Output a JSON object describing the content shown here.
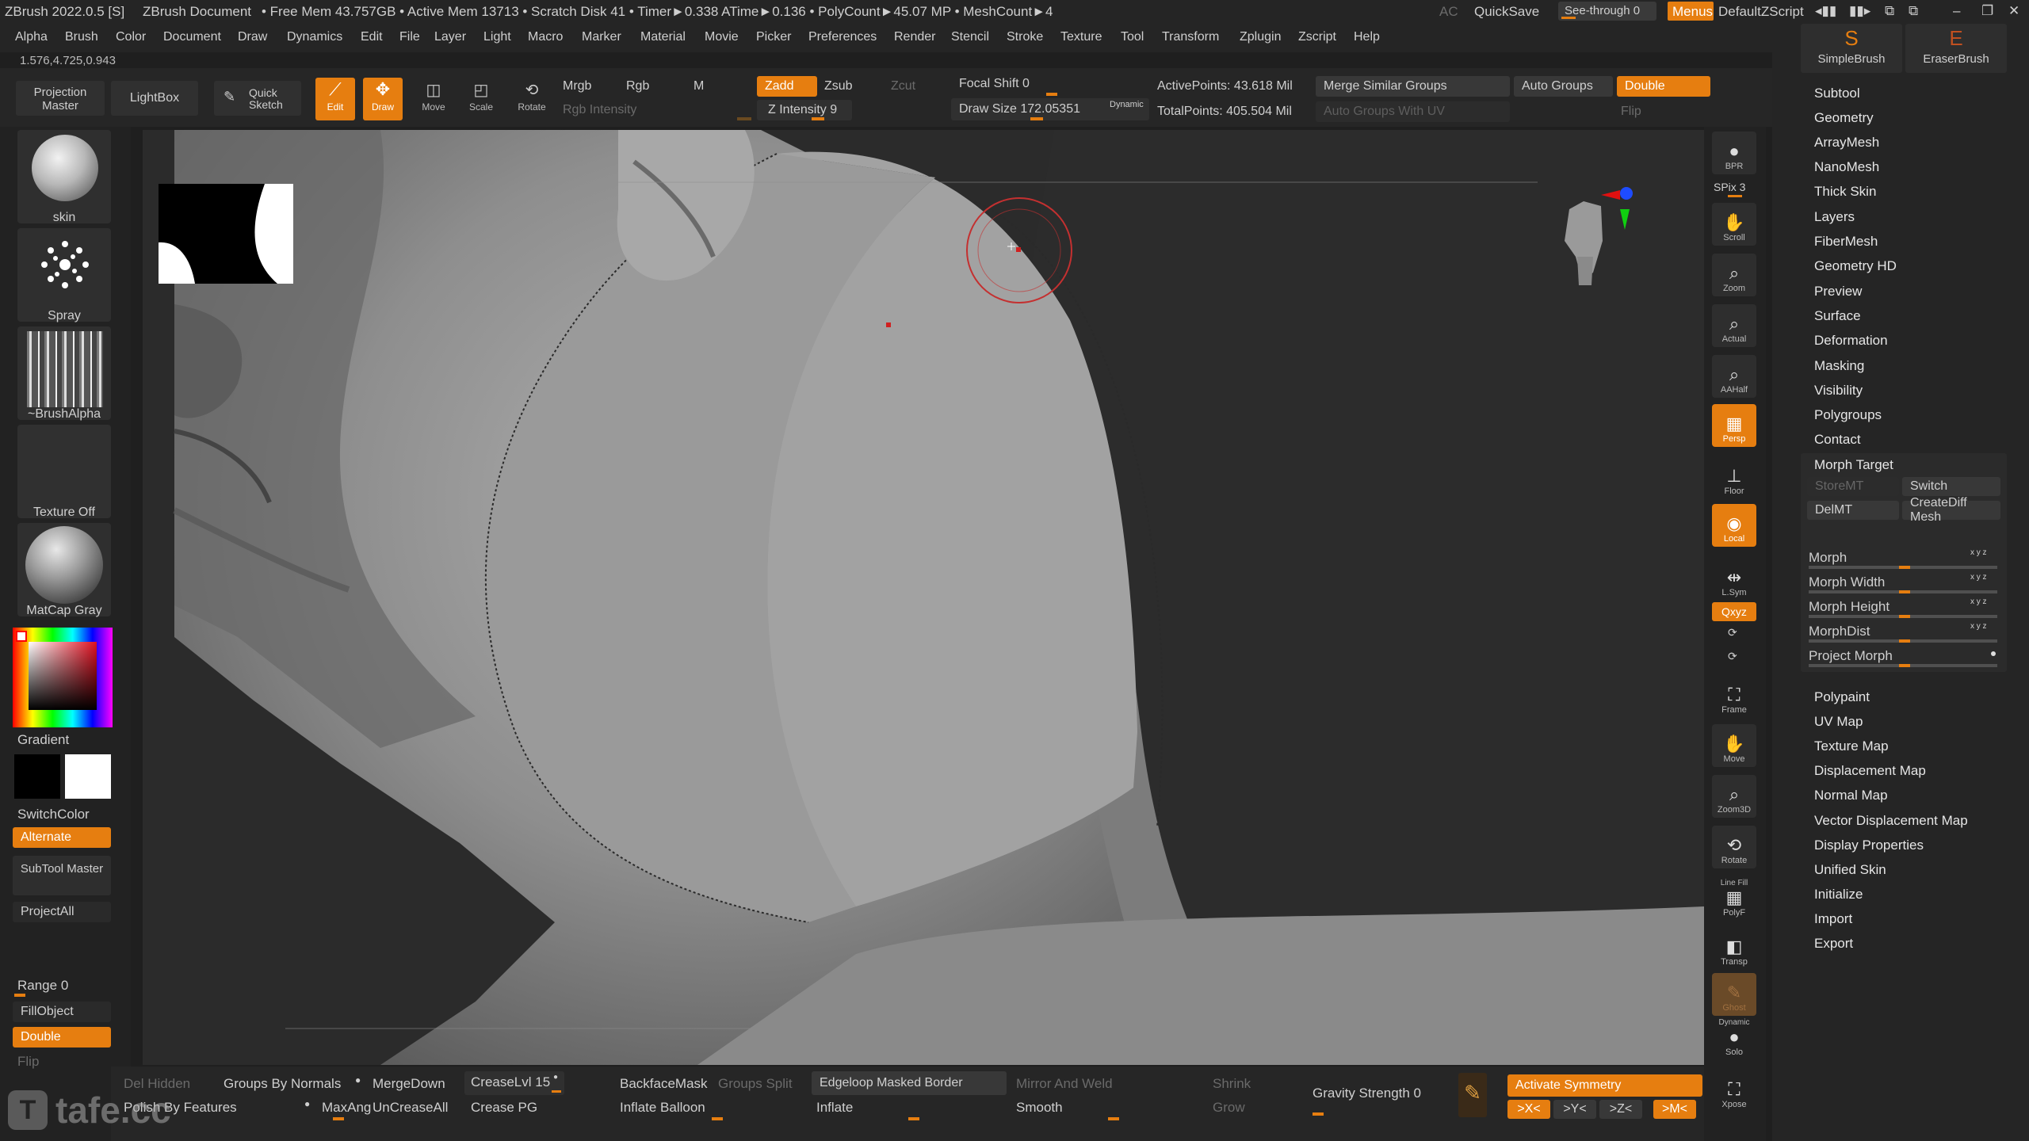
{
  "titlebar": {
    "app_title": "ZBrush 2022.0.5 [S]",
    "document": "ZBrush Document",
    "stats": "• Free Mem 43.757GB • Active Mem 13713 • Scratch Disk 41 • Timer►0.338 ATime►0.136 • PolyCount►45.07 MP • MeshCount►4",
    "ac": "AC",
    "quicksave": "QuickSave",
    "see_through": "See-through  0",
    "menus": "Menus",
    "default_zscript": "DefaultZScript"
  },
  "menubar": {
    "items": [
      "Alpha",
      "Brush",
      "Color",
      "Document",
      "Draw",
      "Dynamics",
      "Edit",
      "File",
      "Layer",
      "Light",
      "Macro",
      "Marker",
      "Material",
      "Movie",
      "Picker",
      "Preferences",
      "Render",
      "Stencil",
      "Stroke",
      "Texture",
      "Tool",
      "Transform",
      "Zplugin",
      "Zscript",
      "Help"
    ],
    "coords": "1.576,4.725,0.943"
  },
  "top_toolbar": {
    "projection_master": "Projection Master",
    "lightbox": "LightBox",
    "quick_sketch": "Quick Sketch",
    "edit": "Edit",
    "draw": "Draw",
    "move": "Move",
    "scale": "Scale",
    "rotate": "Rotate",
    "mrgb": "Mrgb",
    "rgb": "Rgb",
    "m": "M",
    "rgb_intensity": "Rgb Intensity",
    "zadd": "Zadd",
    "zsub": "Zsub",
    "zcut": "Zcut",
    "z_intensity": "Z Intensity 9",
    "focal_shift": "Focal Shift 0",
    "draw_size": "Draw Size 172.05351",
    "dynamic": "Dynamic",
    "active_points": "ActivePoints: 43.618 Mil",
    "total_points": "TotalPoints: 405.504 Mil",
    "merge_similar_groups": "Merge Similar Groups",
    "auto_groups": "Auto Groups",
    "double": "Double",
    "auto_groups_with_uv": "Auto Groups With UV",
    "flip": "Flip"
  },
  "left_shelf": {
    "brush_label": "skin",
    "stroke_label": "Spray",
    "alpha_label": "~BrushAlpha",
    "texture_label": "Texture Off",
    "material_label": "MatCap Gray",
    "gradient_label": "Gradient",
    "switchcolor_label": "SwitchColor",
    "alternate_label": "Alternate",
    "subtool_master": "SubTool Master",
    "project_all": "ProjectAll",
    "range": "Range 0",
    "fill_object": "FillObject",
    "double": "Double",
    "flip": "Flip"
  },
  "right_shelf": {
    "bpr": "BPR",
    "spix": "SPix 3",
    "scroll": "Scroll",
    "zoom": "Zoom",
    "actual": "Actual",
    "aahalf": "AAHalf",
    "persp": "Persp",
    "floor": "Floor",
    "local": "Local",
    "lsym": "L.Sym",
    "qxyz": "Qxyz",
    "frame": "Frame",
    "move": "Move",
    "zoom3d": "Zoom3D",
    "rotate": "Rotate",
    "line_fill": "Line Fill",
    "polyf": "PolyF",
    "transp": "Transp",
    "ghost": "Ghost",
    "dynamic": "Dynamic",
    "solo": "Solo",
    "xpose": "Xpose"
  },
  "right_panel": {
    "simple_brush": "SimpleBrush",
    "eraser_brush": "EraserBrush",
    "items_top": [
      "Subtool",
      "Geometry",
      "ArrayMesh",
      "NanoMesh",
      "Thick Skin",
      "Layers",
      "FiberMesh",
      "Geometry HD",
      "Preview",
      "Surface",
      "Deformation",
      "Masking",
      "Visibility",
      "Polygroups",
      "Contact"
    ],
    "morph_target": "Morph Target",
    "store_mt": "StoreMT",
    "switch": "Switch",
    "del_mt": "DelMT",
    "create_diff_mesh": "CreateDiff Mesh",
    "sliders": [
      {
        "label": "Morph",
        "value": 0.5
      },
      {
        "label": "Morph Width",
        "value": 0.5
      },
      {
        "label": "Morph Height",
        "value": 0.5
      },
      {
        "label": "MorphDist",
        "value": 0.5
      },
      {
        "label": "Project Morph",
        "value": 0.5
      }
    ],
    "xyz": "x y z",
    "items_bottom": [
      "Polypaint",
      "UV Map",
      "Texture Map",
      "Displacement Map",
      "Normal Map",
      "Vector Displacement Map",
      "Display Properties",
      "Unified Skin",
      "Initialize",
      "Import",
      "Export"
    ]
  },
  "bottom_bar": {
    "del_hidden": "Del Hidden",
    "groups_by_normals": "Groups By Normals",
    "merge_down": "MergeDown",
    "crease_lvl": "CreaseLvl 15",
    "backface_mask": "BackfaceMask",
    "groups_split": "Groups Split",
    "edgeloop_masked_border": "Edgeloop Masked Border",
    "mirror_and_weld": "Mirror And Weld",
    "shrink": "Shrink",
    "gravity_strength": "Gravity Strength 0",
    "activate_symmetry": "Activate Symmetry",
    "polish_by_features": "Polish By Features",
    "max_angle": "MaxAng",
    "uncrease_all": "UnCreaseAll",
    "crease_pg": "Crease PG",
    "inflate_balloon": "Inflate Balloon",
    "inflate": "Inflate",
    "smooth": "Smooth",
    "grow": "Grow",
    "x_sym": ">X<",
    "y_sym": ">Y<",
    "z_sym": ">Z<",
    "m_sym": ">M<",
    "watermark": "tafe.cc"
  }
}
